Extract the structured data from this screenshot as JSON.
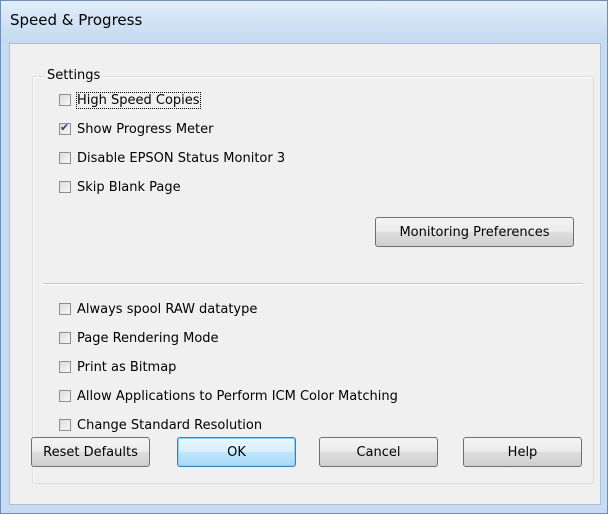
{
  "window": {
    "title": "Speed & Progress"
  },
  "settings": {
    "group_label": "Settings",
    "options_top": [
      {
        "label": "High Speed Copies",
        "checked": false
      },
      {
        "label": "Show Progress Meter",
        "checked": true
      },
      {
        "label": "Disable EPSON Status Monitor 3",
        "checked": false
      },
      {
        "label": "Skip Blank Page",
        "checked": false
      }
    ],
    "monitoring_button": "Monitoring Preferences",
    "options_bottom": [
      {
        "label": "Always spool RAW datatype",
        "checked": false
      },
      {
        "label": "Page Rendering Mode",
        "checked": false
      },
      {
        "label": "Print as Bitmap",
        "checked": false
      },
      {
        "label": "Allow Applications to Perform ICM Color Matching",
        "checked": false
      },
      {
        "label": "Change Standard Resolution",
        "checked": false
      }
    ]
  },
  "buttons": {
    "reset": "Reset Defaults",
    "ok": "OK",
    "cancel": "Cancel",
    "help": "Help"
  },
  "colors": {
    "titlebar": "#cfe1f4",
    "dialog_bg": "#f0f0f0",
    "default_button_border": "#3c7fb1"
  }
}
